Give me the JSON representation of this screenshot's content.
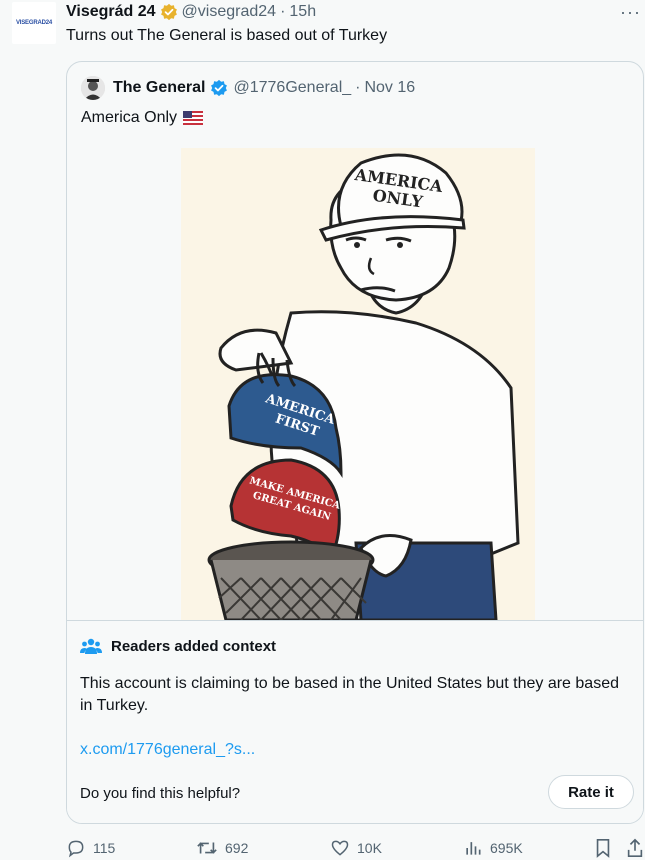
{
  "tweet": {
    "author_name": "Visegrád 24",
    "avatar_text": "VISEGRAD24",
    "handle": "@visegrad24",
    "separator": "·",
    "time": "15h",
    "more": "···",
    "text": "Turns out The General is based out of Turkey"
  },
  "quote": {
    "author_name": "The General",
    "handle": "@1776General_",
    "separator": "·",
    "date": "Nov 16",
    "text": "America Only",
    "image": {
      "hat_top": [
        "AMERICA",
        "ONLY"
      ],
      "hat_blue": [
        "AMERICA",
        "FIRST"
      ],
      "hat_red": [
        "MAKE AMERICA",
        "GREAT AGAIN"
      ]
    }
  },
  "community_note": {
    "title": "Readers added context",
    "body": "This account is claiming to be based in the United States but they are based in Turkey.",
    "link": "x.com/1776general_?s...",
    "question": "Do you find this helpful?",
    "rate_button": "Rate it"
  },
  "actions": {
    "replies": "115",
    "reposts": "692",
    "likes": "10K",
    "views": "695K"
  },
  "colors": {
    "accent": "#1d9bf0",
    "text": "#0f1419",
    "muted": "#536471",
    "gold_badge": "#e8b22d",
    "blue_hat": "#2d5a8f",
    "red_hat": "#b63334"
  }
}
